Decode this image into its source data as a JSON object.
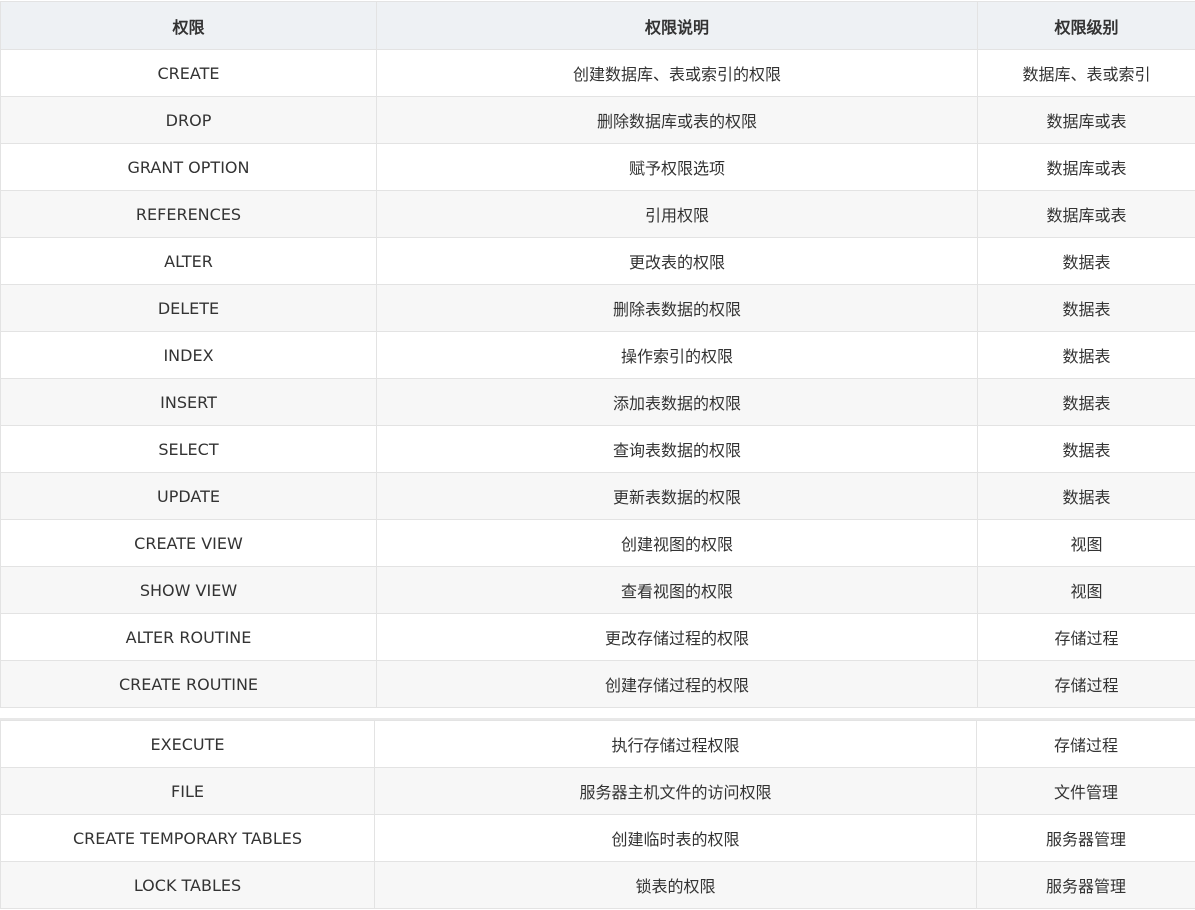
{
  "table": {
    "headers": [
      "权限",
      "权限说明",
      "权限级别"
    ],
    "rows_top": [
      [
        "CREATE",
        "创建数据库、表或索引的权限",
        "数据库、表或索引"
      ],
      [
        "DROP",
        "删除数据库或表的权限",
        "数据库或表"
      ],
      [
        "GRANT OPTION",
        "赋予权限选项",
        "数据库或表"
      ],
      [
        "REFERENCES",
        "引用权限",
        "数据库或表"
      ],
      [
        "ALTER",
        "更改表的权限",
        "数据表"
      ],
      [
        "DELETE",
        "删除表数据的权限",
        "数据表"
      ],
      [
        "INDEX",
        "操作索引的权限",
        "数据表"
      ],
      [
        "INSERT",
        "添加表数据的权限",
        "数据表"
      ],
      [
        "SELECT",
        "查询表数据的权限",
        "数据表"
      ],
      [
        "UPDATE",
        "更新表数据的权限",
        "数据表"
      ],
      [
        "CREATE VIEW",
        "创建视图的权限",
        "视图"
      ],
      [
        "SHOW VIEW",
        "查看视图的权限",
        "视图"
      ],
      [
        "ALTER ROUTINE",
        "更改存储过程的权限",
        "存储过程"
      ],
      [
        "CREATE ROUTINE",
        "创建存储过程的权限",
        "存储过程"
      ]
    ],
    "rows_bottom": [
      [
        "EXECUTE",
        "执行存储过程权限",
        "存储过程"
      ],
      [
        "FILE",
        "服务器主机文件的访问权限",
        "文件管理"
      ],
      [
        "CREATE TEMPORARY TABLES",
        "创建临时表的权限",
        "服务器管理"
      ],
      [
        "LOCK TABLES",
        "锁表的权限",
        "服务器管理"
      ]
    ]
  }
}
